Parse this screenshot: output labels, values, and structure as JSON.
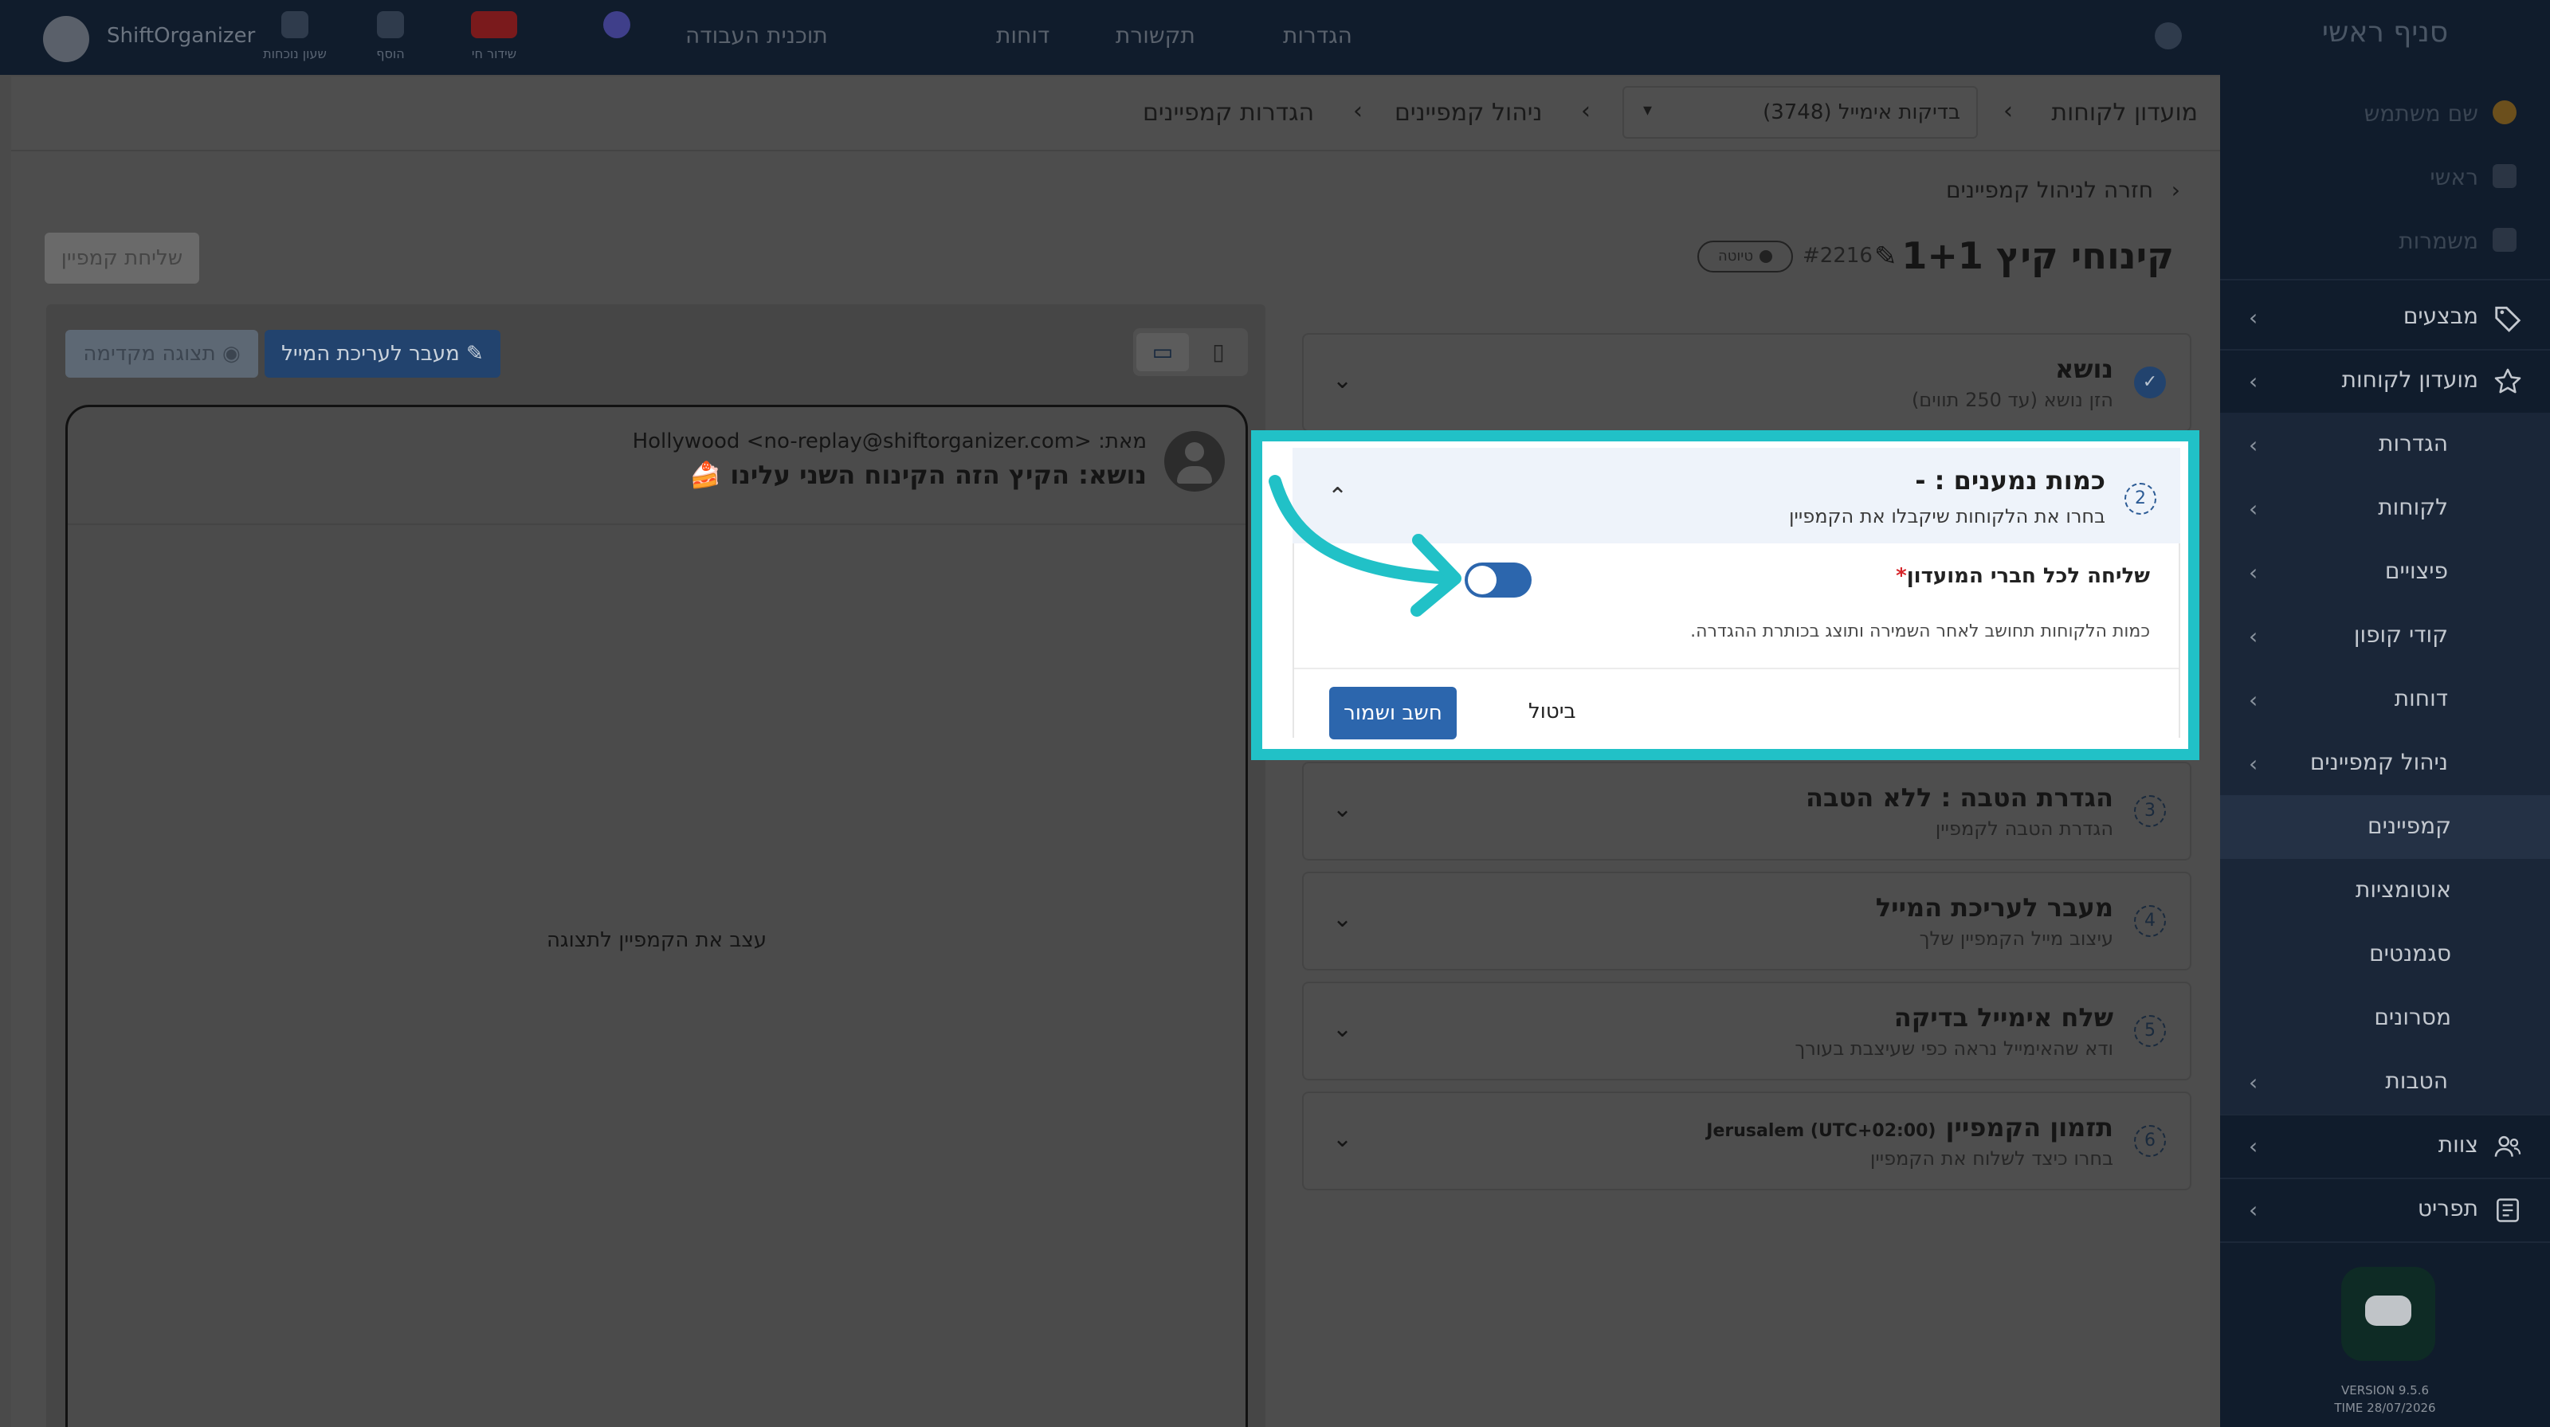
{
  "topbar": {
    "logo_text": "ShiftOrganizer",
    "items": [
      {
        "icon": "clock-icon",
        "label": "שעון נוכחות"
      },
      {
        "icon": "plus-icon",
        "label": "הוסף"
      },
      {
        "icon": "live-icon",
        "label": "שידור חי"
      }
    ],
    "nav": [
      "תוכנית העבודה",
      "דוחות",
      "תקשורת",
      "הגדרות"
    ]
  },
  "sidebar": {
    "brand": "סניף ראשי",
    "items": [
      {
        "label": "שם משתמש",
        "icon": "user-icon",
        "dim": true
      },
      {
        "label": "ראשי",
        "icon": "home-icon",
        "dim": true
      },
      {
        "label": "משמרות",
        "icon": "calendar-icon",
        "dim": true
      },
      {
        "label": "מבצעים",
        "icon": "tag-icon",
        "chevron": true
      },
      {
        "label": "מועדון לקוחות",
        "icon": "star-icon",
        "chevron": true
      },
      {
        "label": "הגדרות",
        "chevron": true
      },
      {
        "label": "לקוחות",
        "chevron": true
      },
      {
        "label": "פיצויים",
        "chevron": true
      },
      {
        "label": "קודי קופון",
        "chevron": true
      },
      {
        "label": "דוחות",
        "chevron": true
      },
      {
        "label": "ניהול קמפיינים",
        "chevron": true
      },
      {
        "label": "קמפיינים",
        "active": true
      },
      {
        "label": "אוטומציות",
        "sub": true
      },
      {
        "label": "סגמנטים",
        "sub": true
      },
      {
        "label": "מסרונים",
        "sub": true
      },
      {
        "label": "הטבות",
        "chevron": true
      },
      {
        "label": "צוות",
        "icon": "team-icon",
        "chevron": true
      },
      {
        "label": "תפריט",
        "icon": "menu-icon",
        "chevron": true
      }
    ],
    "version": "VERSION 9.5.6",
    "time": "TIME 28/07/2026"
  },
  "breadcrumb": {
    "root": "מועדון לקוחות",
    "branch": "(3748) בדיקות אימייל",
    "section": "ניהול קמפיינים",
    "page": "הגדרות קמפיינים"
  },
  "campaign": {
    "back_link": "חזרה לניהול קמפיינים",
    "title": "קינוחי קיץ 1+1",
    "id": "#2216",
    "status": "טיוטה",
    "send_button": "שליחת קמפיין"
  },
  "preview": {
    "edit_email_button": "מעבר לעריכת המייל",
    "show_preview_button": "תצוגה מקדימה",
    "from_label": "מאת:",
    "from_value": "Hollywood <no-replay@shiftorganizer.com>",
    "subject_label": "נושא:",
    "subject_value": "הקיץ הזה הקינוח השני עלינו 🍰",
    "empty_text": "עצב את הקמפיין לתצוגה"
  },
  "steps": [
    {
      "num": "✓",
      "title": "נושא",
      "subtitle": "הזן נושא (עד 250 תווים)",
      "done": true
    },
    {
      "num": "2",
      "title": "כמות נמענים : -",
      "subtitle": "בחרו את הלקוחות שיקבלו את הקמפיין"
    },
    {
      "num": "3",
      "title": "הגדרת הטבה : ללא הטבה",
      "subtitle": "הגדרת הטבה לקמפיין"
    },
    {
      "num": "4",
      "title": "מעבר לעריכת המייל",
      "subtitle": "עיצוב מייל הקמפיין שלך"
    },
    {
      "num": "5",
      "title": "שלח אימייל בדיקה",
      "subtitle": "ודא שהאימייל נראה כפי שעיצבת בעורך"
    },
    {
      "num": "6",
      "title": "תזמון הקמפיין",
      "title_extra": "Jerusalem (UTC+02:00)",
      "subtitle": "בחרו כיצד לשלוח את הקמפיין"
    }
  ],
  "step2": {
    "toggle_label": "שליחה לכל חברי המועדון",
    "required_mark": "*",
    "toggle_on": false,
    "help_text": "כמות הלקוחות תחושב לאחר השמירה ותוצג בכותרת ההגדרה.",
    "save_button": "חשב ושמור",
    "cancel_button": "ביטול"
  },
  "colors": {
    "highlight": "#21c1c7",
    "primary": "#2c66ad",
    "sidebar_bg": "#101c2c"
  }
}
